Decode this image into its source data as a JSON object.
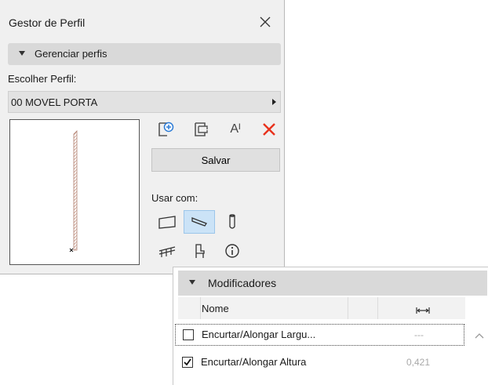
{
  "palette": {
    "title": "Gestor de Perfil",
    "section_label": "Gerenciar perfis",
    "choose_label": "Escolher Perfil:",
    "selected_profile": "00 MOVEL PORTA",
    "tools": {
      "new_profile_icon": "new-profile-icon",
      "duplicate_icon": "duplicate-profile-icon",
      "rename_label": "Aᴵ",
      "delete_icon": "delete-x-icon",
      "delete_color": "#e8321c"
    },
    "save_label": "Salvar",
    "use_with_label": "Usar com:",
    "use_with_items": [
      {
        "icon": "wall-icon",
        "active": false
      },
      {
        "icon": "beam-icon",
        "active": true
      },
      {
        "icon": "column-icon",
        "active": false
      },
      {
        "icon": "railing-icon",
        "active": false
      },
      {
        "icon": "chair-object-icon",
        "active": false
      },
      {
        "icon": "info-icon",
        "active": false
      }
    ]
  },
  "modifiers": {
    "title": "Modificadores",
    "columns": {
      "name": "Nome",
      "value_icon": "width-arrows-icon"
    },
    "rows": [
      {
        "checked": false,
        "name": "Encurtar/Alongar Largu...",
        "value": "---"
      },
      {
        "checked": true,
        "name": "Encurtar/Alongar Altura",
        "value": "0,421"
      }
    ]
  },
  "colors": {
    "accent_active_bg": "#cbe3f7",
    "panel_bg": "#f0f0f0",
    "bar_bg": "#d9d9d9"
  }
}
